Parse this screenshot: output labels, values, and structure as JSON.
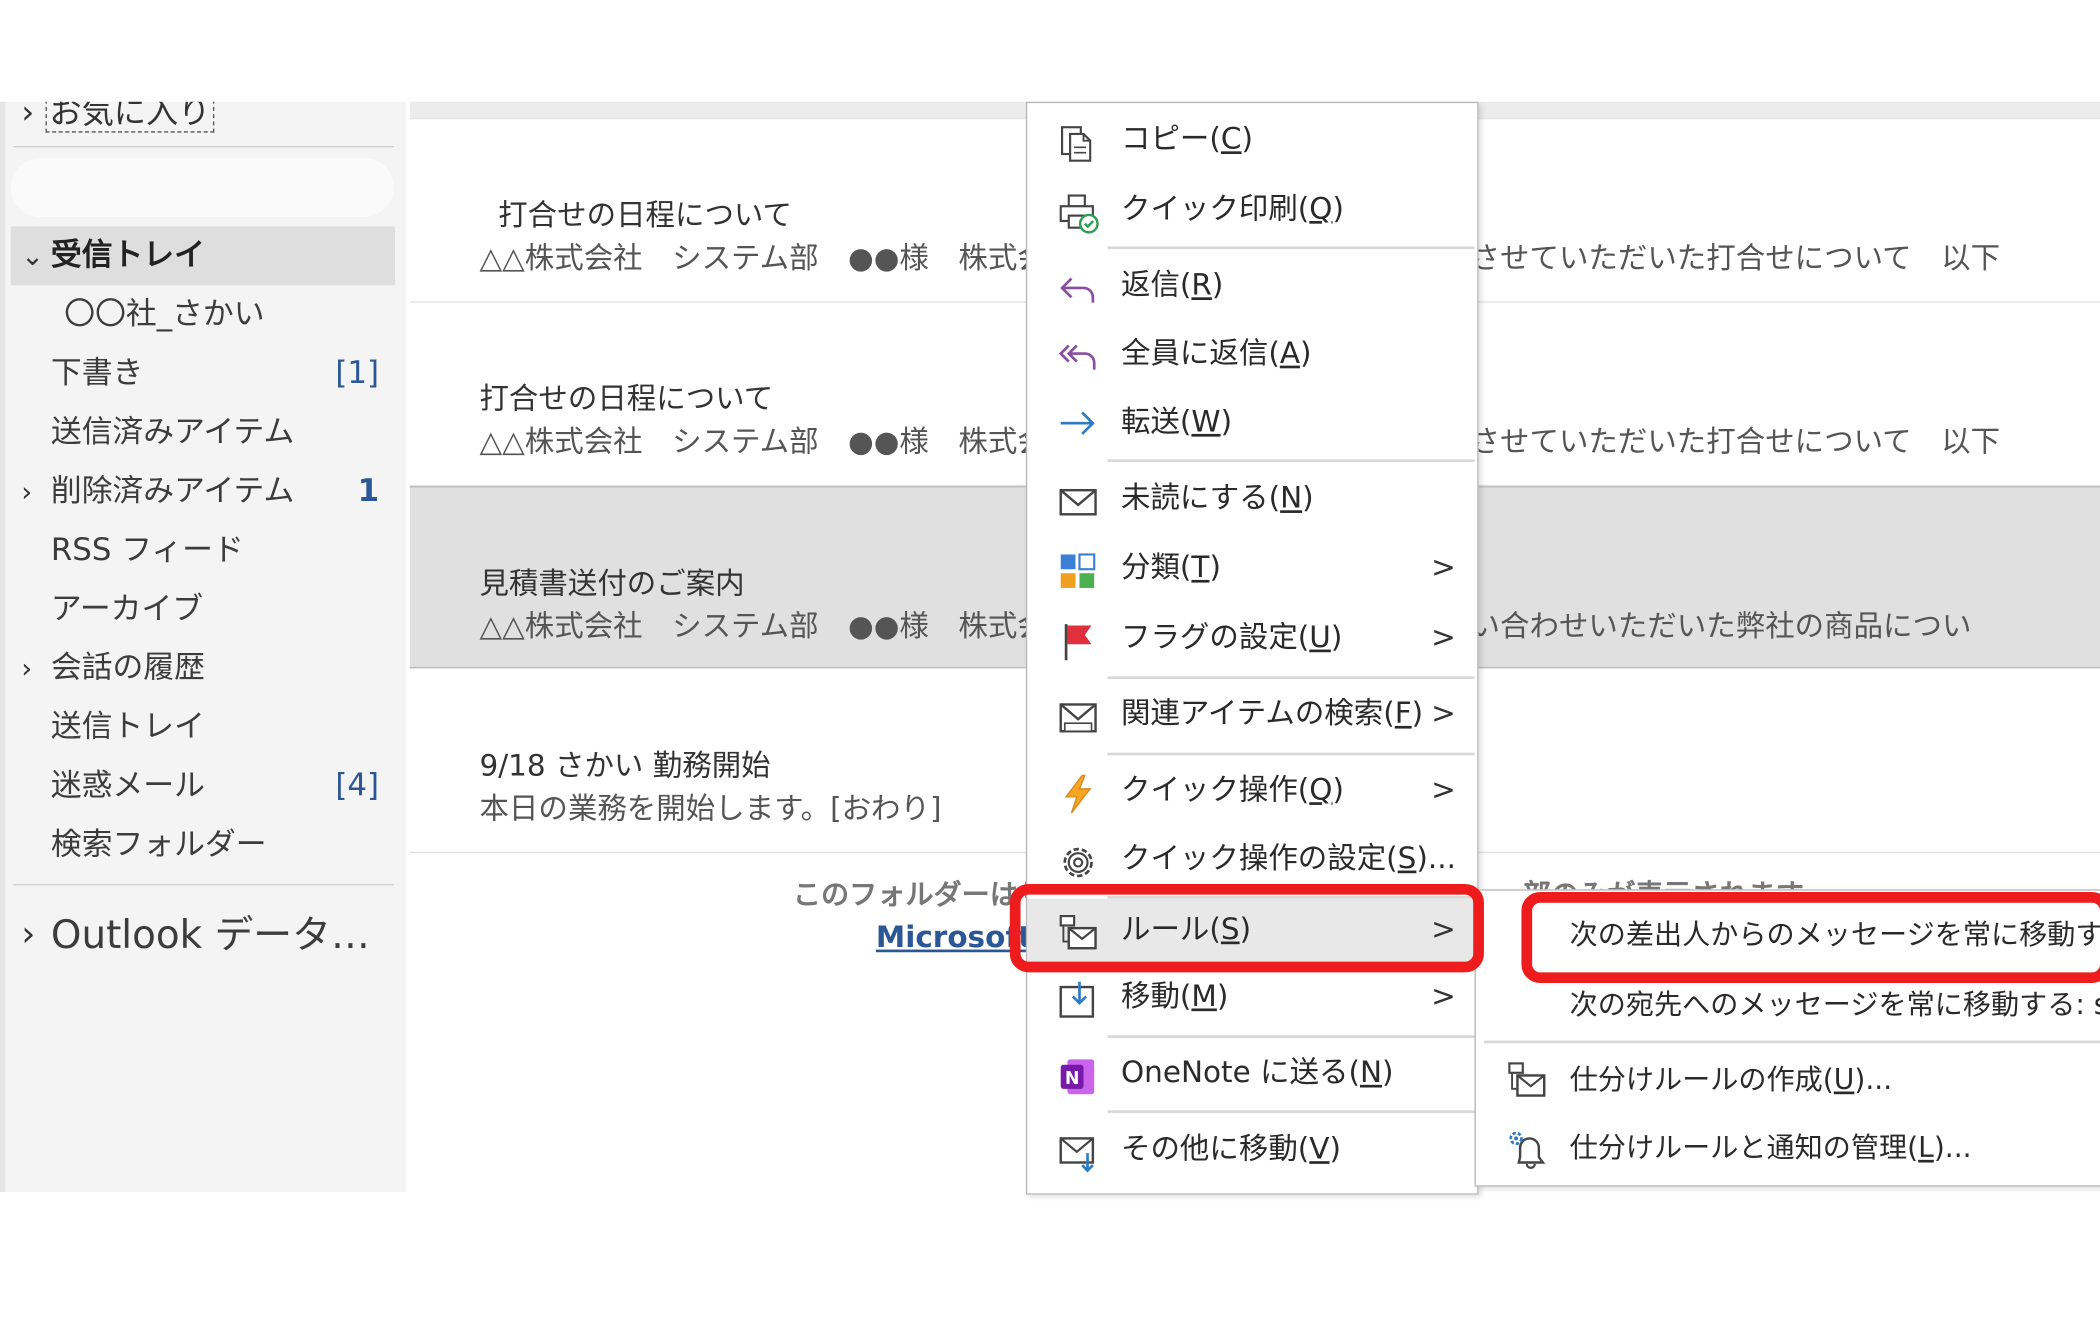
{
  "folders": {
    "favorites": "お気に入り",
    "items": [
      {
        "label": "受信トレイ",
        "chevron": "v",
        "selected": true
      },
      {
        "label": "〇〇社_さかい"
      },
      {
        "label": "下書き",
        "count": "[1]"
      },
      {
        "label": "送信済みアイテム"
      },
      {
        "label": "削除済みアイテム",
        "chevron": ">",
        "count": "1"
      },
      {
        "label": "RSS フィード"
      },
      {
        "label": "アーカイブ"
      },
      {
        "label": "会話の履歴",
        "chevron": ">"
      },
      {
        "label": "送信トレイ"
      },
      {
        "label": "迷惑メール",
        "count": "[4]"
      },
      {
        "label": "検索フォルダー"
      }
    ],
    "data_file": "Outlook データ…"
  },
  "messages": [
    {
      "subject": "打合せの日程について",
      "preview": "△△株式会社　システム部　●●様　株式会社",
      "preview_right": "させていただいた打合せについて　以下"
    },
    {
      "subject": "打合せの日程について",
      "preview": "△△株式会社　システム部　●●様　株式会社",
      "preview_right": "させていただいた打合せについて　以下"
    },
    {
      "subject": "見積書送付のご案内",
      "preview": "△△株式会社　システム部　●●様　株式会社",
      "preview_right": "い合わせいただいた弊社の商品につい",
      "selected": true
    },
    {
      "subject": "9/18 さかい 勤務開始",
      "preview": "本日の業務を開始します。[おわり]"
    }
  ],
  "folder_note_left": "このフォルダーはサー",
  "folder_note_right": "ー部のみが表示されます。",
  "microsoft_link": "Microsoft",
  "context_menu": {
    "items": [
      {
        "icon": "copy-icon",
        "text": "コピー(",
        "key": "C",
        "end": ")"
      },
      {
        "icon": "quick-print-icon",
        "text": "クイック印刷(",
        "key": "Q",
        "end": ")"
      },
      {
        "icon": "reply-icon",
        "text": "返信(",
        "key": "R",
        "end": ")"
      },
      {
        "icon": "reply-all-icon",
        "text": "全員に返信(",
        "key": "A",
        "end": ")"
      },
      {
        "icon": "forward-icon",
        "text": "転送(",
        "key": "W",
        "end": ")"
      },
      {
        "icon": "mark-unread-icon",
        "text": "未読にする(",
        "key": "N",
        "end": ")"
      },
      {
        "icon": "categorize-icon",
        "text": "分類(",
        "key": "T",
        "end": ")",
        "submenu": true
      },
      {
        "icon": "flag-icon",
        "text": "フラグの設定(",
        "key": "U",
        "end": ")",
        "submenu": true
      },
      {
        "icon": "find-related-icon",
        "text": "関連アイテムの検索(",
        "key": "F",
        "end": ")",
        "submenu": true
      },
      {
        "icon": "quick-steps-icon",
        "text": "クイック操作(",
        "key": "Q",
        "end": ")",
        "submenu": true
      },
      {
        "icon": "settings-gear-icon",
        "text": "クイック操作の設定(",
        "key": "S",
        "end": ")..."
      },
      {
        "icon": "rules-icon",
        "text": "ルール(",
        "key": "S",
        "end": ")",
        "submenu": true,
        "highlighted": true
      },
      {
        "icon": "move-icon",
        "text": "移動(",
        "key": "M",
        "end": ")",
        "submenu": true
      },
      {
        "icon": "onenote-icon",
        "text": "OneNote に送る(",
        "key": "N",
        "end": ")"
      },
      {
        "icon": "move-other-icon",
        "text": "その他に移動(",
        "key": "V",
        "end": ")"
      }
    ]
  },
  "rules_submenu": {
    "items": [
      {
        "text": "次の差出人からのメッセージを常に移動する:"
      },
      {
        "text": "次の宛先へのメッセージを常に移動する: saka"
      },
      {
        "icon": "create-rule-icon",
        "text": "仕分けルールの作成(",
        "key": "U",
        "end": ")..."
      },
      {
        "icon": "manage-rules-icon",
        "text": "仕分けルールと通知の管理(",
        "key": "L",
        "end": ")..."
      }
    ]
  },
  "colors": {
    "callout": "#ee1c1c",
    "link": "#2b5797",
    "reply": "#8a4ea0",
    "forward": "#2e7bc4"
  }
}
